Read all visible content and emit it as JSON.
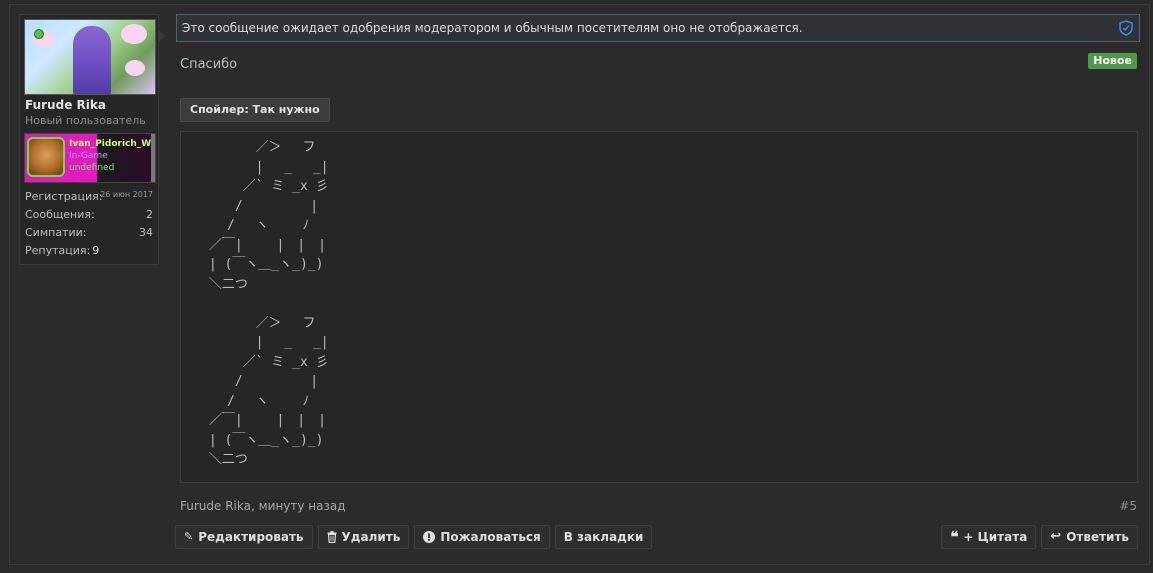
{
  "user": {
    "name": "Furude Rika",
    "title": "Новый пользователь",
    "banner": {
      "line1": "Ivan_Pidorich_Wak…",
      "line2": "In-Game",
      "line3": "undefined"
    },
    "stats": [
      {
        "label": "Регистрация:",
        "value": "26 июн 2017"
      },
      {
        "label": "Сообщения:",
        "value": "2"
      },
      {
        "label": "Симпатии:",
        "value": "34"
      },
      {
        "label": "Репутация:",
        "value": "9"
      }
    ]
  },
  "post": {
    "moderation_notice": "Это сообщение ожидает одобрения модератором и обычным посетителям оно не отображается.",
    "text": "Спасибо",
    "badge": "Новое",
    "spoiler_label": "Спойлер: Так нужно",
    "ascii_art": "　　 　 ／＞　 フ\n　　 　 |　 _　 _|\n　 　 ／` ミ _x 彡\n　　 /　　　 　 |\n　　/　 ヽ　　 ﾉ\n ／￣|　　 |　|　|\n | (￣ヽ＿_ヽ_)_)\n ＼二つ\n\n　　 　 ／＞　 フ\n　　 　 |　 _　 _|\n　 　 ／` ミ _x 彡\n　　 /　　　 　 |\n　　/　 ヽ　　 ﾉ\n ／￣|　　 |　|　|\n | (￣ヽ＿_ヽ_)_)\n ＼二つ",
    "meta": "Furude Rika, минуту назад",
    "number": "#5"
  },
  "actions": {
    "edit": "Редактировать",
    "delete": "Удалить",
    "report": "Пожаловаться",
    "bookmark": "В закладки",
    "quote": "+ Цитата",
    "reply": "Ответить"
  },
  "colors": {
    "background": "#2a2a2a",
    "badge_green": "#4f9a4a",
    "online": "#4ec440",
    "moderation_border": "#4e6470"
  }
}
